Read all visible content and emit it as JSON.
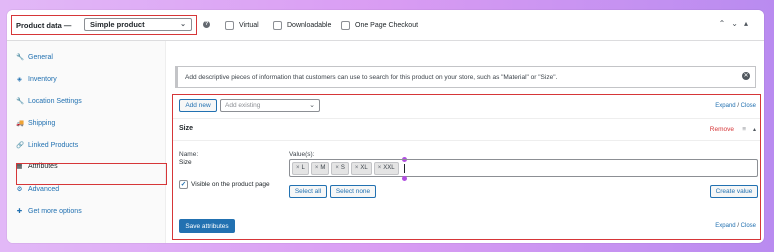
{
  "header": {
    "product_data_label": "Product data —",
    "product_type": "Simple product",
    "help_glyph": "?",
    "checkboxes": [
      {
        "label": "Virtual",
        "checked": false
      },
      {
        "label": "Downloadable",
        "checked": false
      },
      {
        "label": "One Page Checkout",
        "checked": false
      }
    ]
  },
  "sidebar": {
    "items": [
      {
        "label": "General",
        "icon": "wrench-icon",
        "glyph": "🔧",
        "active": false
      },
      {
        "label": "Inventory",
        "icon": "inventory-icon",
        "glyph": "◈",
        "active": false
      },
      {
        "label": "Location Settings",
        "icon": "wrench-icon",
        "glyph": "🔧",
        "active": false
      },
      {
        "label": "Shipping",
        "icon": "truck-icon",
        "glyph": "🚚",
        "active": false
      },
      {
        "label": "Linked Products",
        "icon": "link-icon",
        "glyph": "🔗",
        "active": false
      },
      {
        "label": "Attributes",
        "icon": "table-icon",
        "glyph": "▦",
        "active": true
      },
      {
        "label": "Advanced",
        "icon": "gear-icon",
        "glyph": "⚙",
        "active": false
      },
      {
        "label": "Get more options",
        "icon": "plug-icon",
        "glyph": "✚",
        "active": false
      }
    ]
  },
  "notice": {
    "text": "Add descriptive pieces of information that customers can use to search for this product on your store, such as \"Material\" or \"Size\".",
    "close_glyph": "✕"
  },
  "attributes": {
    "add_new_label": "Add new",
    "add_existing_placeholder": "Add existing",
    "expand_label": "Expand",
    "close_label": "Close",
    "separator": "/",
    "attribute": {
      "title": "Size",
      "remove_label": "Remove",
      "name_label": "Name:",
      "name_value": "Size",
      "values_label": "Value(s):",
      "values": [
        "L",
        "M",
        "S",
        "XL",
        "XXL"
      ],
      "visible_label": "Visible on the product page",
      "visible_checked": true,
      "select_all_label": "Select all",
      "select_none_label": "Select none",
      "create_value_label": "Create value"
    },
    "save_label": "Save attributes"
  },
  "colors": {
    "accent": "#2271b1",
    "highlight": "#d63638",
    "marker": "#b04fe0"
  }
}
